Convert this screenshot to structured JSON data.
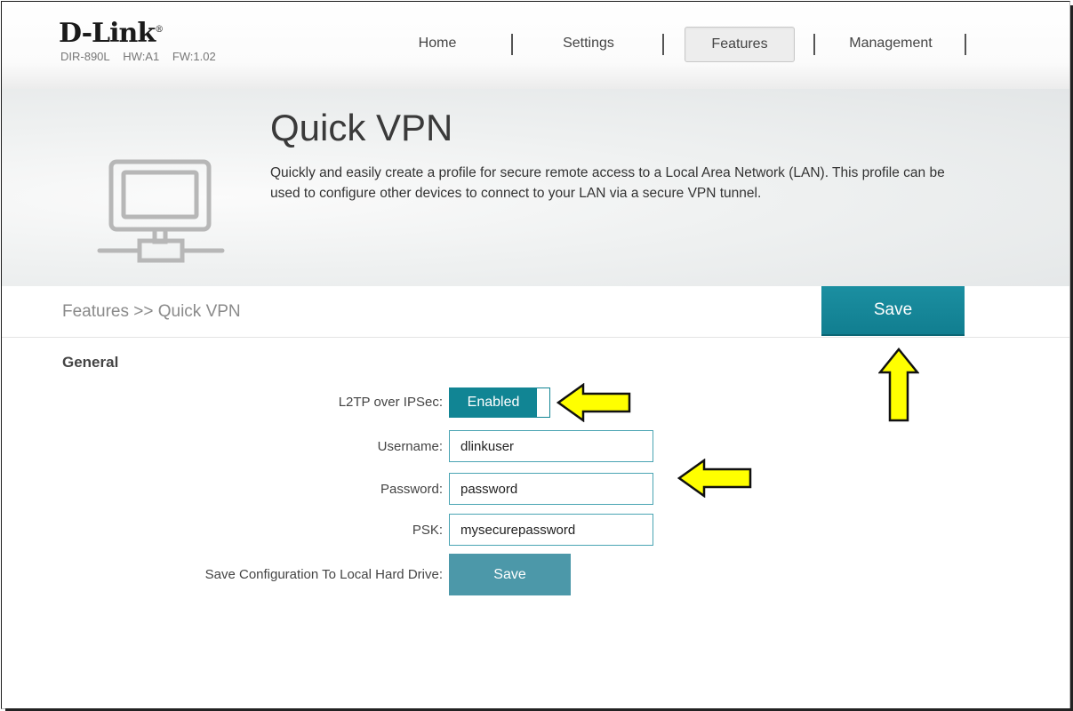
{
  "header": {
    "brand": "D-Link",
    "brand_mark": "®",
    "model": "DIR-890L",
    "hw": "HW:A1",
    "fw": "FW:1.02"
  },
  "nav": [
    {
      "label": "Home",
      "active": false
    },
    {
      "label": "Settings",
      "active": false
    },
    {
      "label": "Features",
      "active": true
    },
    {
      "label": "Management",
      "active": false
    }
  ],
  "banner": {
    "title": "Quick VPN",
    "description": "Quickly and easily create a profile for secure remote access to a Local Area Network (LAN). This profile can be used to configure other devices to connect to your LAN via a secure VPN tunnel.",
    "icon": "network-monitor-icon"
  },
  "breadcrumb": "Features >> Quick VPN",
  "toolbar": {
    "save_label": "Save"
  },
  "general": {
    "title": "General",
    "l2tp": {
      "label": "L2TP over IPSec:",
      "state": "Enabled"
    },
    "username": {
      "label": "Username:",
      "value": "dlinkuser"
    },
    "password": {
      "label": "Password:",
      "value": "password"
    },
    "psk": {
      "label": "PSK:",
      "value": "mysecurepassword"
    },
    "save_config": {
      "label": "Save Configuration To Local Hard Drive:",
      "button": "Save"
    }
  },
  "colors": {
    "accent": "#118594",
    "annotation_arrow": "#ffff00"
  }
}
